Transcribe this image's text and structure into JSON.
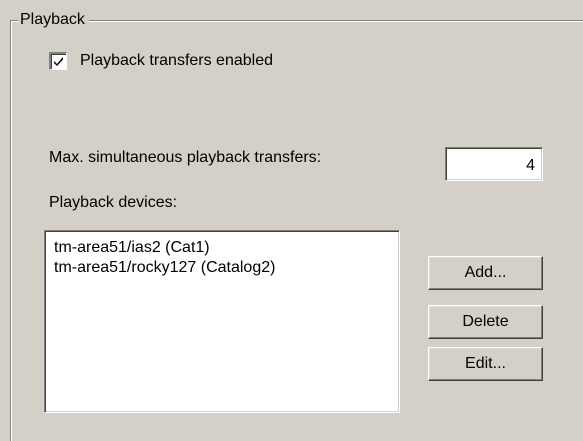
{
  "group": {
    "title": "Playback"
  },
  "checkbox": {
    "label": "Playback transfers enabled",
    "checked": true
  },
  "max_transfers": {
    "label": "Max. simultaneous playback transfers:",
    "value": "4"
  },
  "devices": {
    "label": "Playback devices:",
    "items": [
      "tm-area51/ias2  (Cat1)",
      "tm-area51/rocky127  (Catalog2)"
    ]
  },
  "buttons": {
    "add": "Add...",
    "delete": "Delete",
    "edit": "Edit..."
  }
}
